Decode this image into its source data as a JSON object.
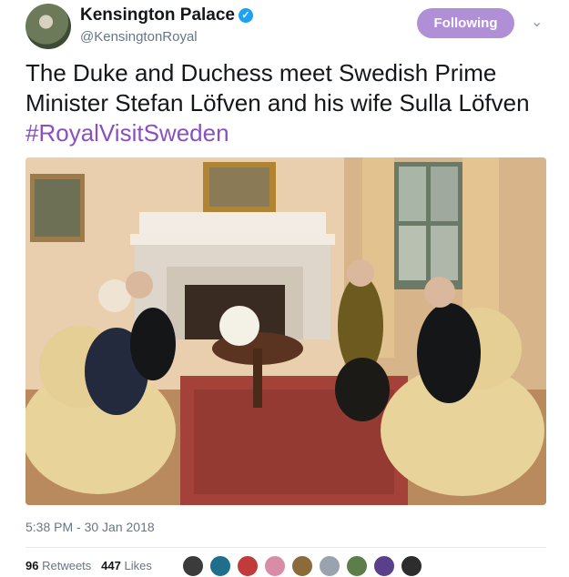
{
  "tweet": {
    "author_name": "Kensington Palace",
    "author_handle": "@KensingtonRoyal",
    "follow_label": "Following",
    "text": "The Duke and Duchess meet Swedish Prime Minister Stefan Löfven and his wife Sulla Löfven ",
    "hashtag": "#RoyalVisitSweden",
    "timestamp": "5:38 PM - 30 Jan 2018",
    "retweets_count": "96",
    "retweets_label": "Retweets",
    "likes_count": "447",
    "likes_label": "Likes"
  },
  "icons": {
    "verified": "verified-badge-icon",
    "caret": "chevron-down-icon"
  },
  "colors": {
    "follow_button": "#b08fd6",
    "hashtag": "#8a4fc1",
    "verified": "#1da1f2",
    "secondary_text": "#657786"
  }
}
